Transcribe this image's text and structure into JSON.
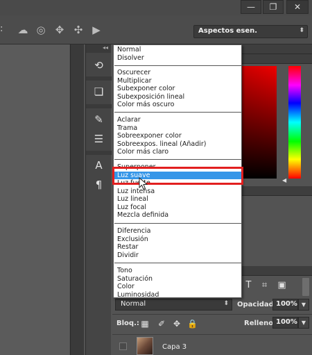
{
  "window": {
    "controls": [
      "—",
      "❐",
      "✕"
    ]
  },
  "options_bar": {
    "leading_char": ":",
    "icons": [
      "cloud-icon",
      "target-icon",
      "move-icon",
      "move-cross-icon",
      "camera-icon"
    ],
    "workspace": "Aspectos esen."
  },
  "dock": {
    "icons": [
      "history-icon",
      "3d-icon",
      "brush-presets-icon",
      "adjustments-icon",
      "character-icon",
      "paragraph-icon"
    ]
  },
  "blend_menu": {
    "groups": [
      [
        "Normal",
        "Disolver"
      ],
      [
        "Oscurecer",
        "Multiplicar",
        "Subexponer color",
        "Subexposición lineal",
        "Color más oscuro"
      ],
      [
        "Aclarar",
        "Trama",
        "Sobreexponer color",
        "Sobreexpos. lineal (Añadir)",
        "Color más claro"
      ],
      [
        "Superponer",
        "Luz suave",
        "Luz fuerte",
        "Luz intensa",
        "Luz lineal",
        "Luz focal",
        "Mezcla definida"
      ],
      [
        "Diferencia",
        "Exclusión",
        "Restar",
        "Dividir"
      ],
      [
        "Tono",
        "Saturación",
        "Color",
        "Luminosidad"
      ]
    ],
    "highlighted": "Luz suave"
  },
  "layers": {
    "blend_mode": "Normal",
    "opacity_label": "Opacidad:",
    "opacity_value": "100%",
    "lock_label": "Bloq.:",
    "fill_label": "Relleno:",
    "fill_value": "100%",
    "layer_name": "Capa 3"
  },
  "colors": {
    "accent": "#3596e8",
    "highlight_frame": "#e21f1f"
  }
}
